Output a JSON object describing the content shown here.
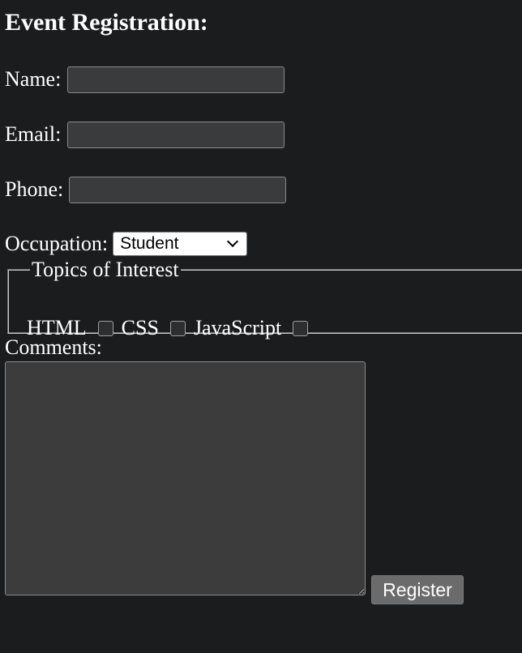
{
  "heading": "Event Registration:",
  "form": {
    "name_label": "Name:",
    "name_value": "",
    "email_label": "Email:",
    "email_value": "",
    "phone_label": "Phone:",
    "phone_value": "",
    "occupation_label": "Occupation:",
    "occupation_selected": "Student",
    "topics_legend": "Topics of Interest",
    "topics": [
      {
        "label": "HTML",
        "checked": false
      },
      {
        "label": "CSS",
        "checked": false
      },
      {
        "label": "JavaScript",
        "checked": false
      }
    ],
    "comments_label": "Comments:",
    "comments_value": "",
    "register_label": "Register"
  }
}
